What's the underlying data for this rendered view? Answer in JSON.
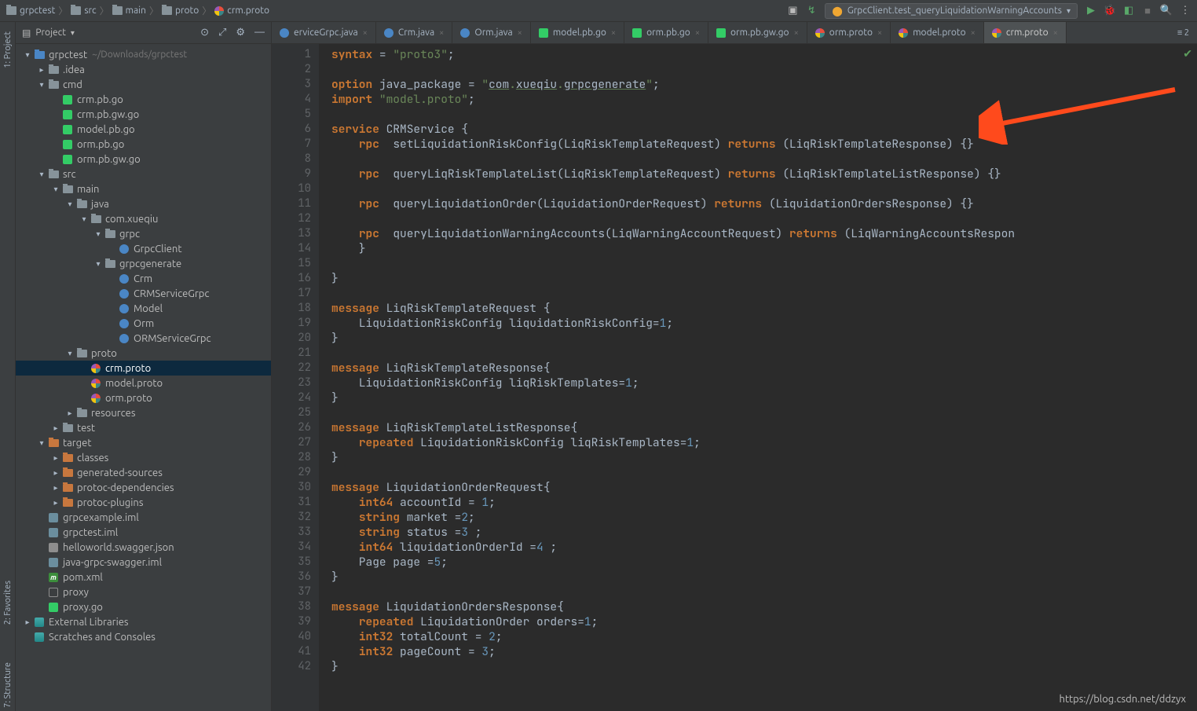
{
  "breadcrumb": [
    "grpctest",
    "src",
    "main",
    "proto",
    "crm.proto"
  ],
  "run_config": "GrpcClient.test_queryLiquidationWarningAccounts",
  "sidebar_title": "Project",
  "toolwindows": [
    "1: Project",
    "2: Favorites",
    "7: Structure"
  ],
  "tree": [
    {
      "d": 0,
      "t": "v",
      "i": "folder-blue",
      "l": "grpctest",
      "h": "~/Downloads/grpctest"
    },
    {
      "d": 1,
      "t": ">",
      "i": "folder",
      "l": ".idea"
    },
    {
      "d": 1,
      "t": "v",
      "i": "folder",
      "l": "cmd"
    },
    {
      "d": 2,
      "t": "",
      "i": "go",
      "l": "crm.pb.go"
    },
    {
      "d": 2,
      "t": "",
      "i": "go",
      "l": "crm.pb.gw.go"
    },
    {
      "d": 2,
      "t": "",
      "i": "go",
      "l": "model.pb.go"
    },
    {
      "d": 2,
      "t": "",
      "i": "go",
      "l": "orm.pb.go"
    },
    {
      "d": 2,
      "t": "",
      "i": "go",
      "l": "orm.pb.gw.go"
    },
    {
      "d": 1,
      "t": "v",
      "i": "folder",
      "l": "src"
    },
    {
      "d": 2,
      "t": "v",
      "i": "folder",
      "l": "main"
    },
    {
      "d": 3,
      "t": "v",
      "i": "folder",
      "l": "java"
    },
    {
      "d": 4,
      "t": "v",
      "i": "folder",
      "l": "com.xueqiu"
    },
    {
      "d": 5,
      "t": "v",
      "i": "folder",
      "l": "grpc"
    },
    {
      "d": 6,
      "t": "",
      "i": "java",
      "l": "GrpcClient"
    },
    {
      "d": 5,
      "t": "v",
      "i": "folder",
      "l": "grpcgenerate"
    },
    {
      "d": 6,
      "t": "",
      "i": "java",
      "l": "Crm"
    },
    {
      "d": 6,
      "t": "",
      "i": "java",
      "l": "CRMServiceGrpc"
    },
    {
      "d": 6,
      "t": "",
      "i": "java",
      "l": "Model"
    },
    {
      "d": 6,
      "t": "",
      "i": "java",
      "l": "Orm"
    },
    {
      "d": 6,
      "t": "",
      "i": "java",
      "l": "ORMServiceGrpc"
    },
    {
      "d": 3,
      "t": "v",
      "i": "folder",
      "l": "proto"
    },
    {
      "d": 4,
      "t": "",
      "i": "proto",
      "l": "crm.proto",
      "sel": true
    },
    {
      "d": 4,
      "t": "",
      "i": "proto",
      "l": "model.proto"
    },
    {
      "d": 4,
      "t": "",
      "i": "proto",
      "l": "orm.proto"
    },
    {
      "d": 3,
      "t": ">",
      "i": "folder",
      "l": "resources"
    },
    {
      "d": 2,
      "t": ">",
      "i": "folder",
      "l": "test"
    },
    {
      "d": 1,
      "t": "v",
      "i": "folder-orange",
      "l": "target"
    },
    {
      "d": 2,
      "t": ">",
      "i": "folder-orange",
      "l": "classes"
    },
    {
      "d": 2,
      "t": ">",
      "i": "folder-orange",
      "l": "generated-sources"
    },
    {
      "d": 2,
      "t": ">",
      "i": "folder-orange",
      "l": "protoc-dependencies"
    },
    {
      "d": 2,
      "t": ">",
      "i": "folder-orange",
      "l": "protoc-plugins"
    },
    {
      "d": 1,
      "t": "",
      "i": "iml",
      "l": "grpcexample.iml"
    },
    {
      "d": 1,
      "t": "",
      "i": "iml",
      "l": "grpctest.iml"
    },
    {
      "d": 1,
      "t": "",
      "i": "json",
      "l": "helloworld.swagger.json"
    },
    {
      "d": 1,
      "t": "",
      "i": "iml",
      "l": "java-grpc-swagger.iml"
    },
    {
      "d": 1,
      "t": "",
      "i": "m",
      "l": "pom.xml"
    },
    {
      "d": 1,
      "t": "",
      "i": "proxy",
      "l": "proxy"
    },
    {
      "d": 1,
      "t": "",
      "i": "go",
      "l": "proxy.go"
    },
    {
      "d": 0,
      "t": ">",
      "i": "lib",
      "l": "External Libraries"
    },
    {
      "d": 0,
      "t": "",
      "i": "lib",
      "l": "Scratches and Consoles"
    }
  ],
  "tabs": [
    {
      "l": "erviceGrpc.java",
      "i": "java"
    },
    {
      "l": "Crm.java",
      "i": "java"
    },
    {
      "l": "Orm.java",
      "i": "java"
    },
    {
      "l": "model.pb.go",
      "i": "go"
    },
    {
      "l": "orm.pb.go",
      "i": "go"
    },
    {
      "l": "orm.pb.gw.go",
      "i": "go"
    },
    {
      "l": "orm.proto",
      "i": "proto"
    },
    {
      "l": "model.proto",
      "i": "proto"
    },
    {
      "l": "crm.proto",
      "i": "proto",
      "active": true
    }
  ],
  "tabs_indicator": "≡ 2",
  "code": [
    [
      [
        "kw",
        "syntax"
      ],
      [
        "",
        " = "
      ],
      [
        "str",
        "\"proto3\""
      ],
      [
        "",
        ";"
      ]
    ],
    [],
    [
      [
        "kw",
        "option"
      ],
      [
        "",
        " java_package = "
      ],
      [
        "str",
        "\""
      ],
      [
        "ul",
        "com"
      ],
      [
        "str",
        "."
      ],
      [
        "ul",
        "xueqiu"
      ],
      [
        "str",
        "."
      ],
      [
        "ul",
        "grpcgenerate"
      ],
      [
        "str",
        "\""
      ],
      [
        "",
        ";"
      ]
    ],
    [
      [
        "kw",
        "import"
      ],
      [
        "",
        " "
      ],
      [
        "str",
        "\"model.proto\""
      ],
      [
        "",
        ";"
      ]
    ],
    [],
    [
      [
        "kw",
        "service"
      ],
      [
        "",
        " CRMService {"
      ]
    ],
    [
      [
        "",
        "    "
      ],
      [
        "kw",
        "rpc"
      ],
      [
        "",
        "  setLiquidationRiskConfig(LiqRiskTemplateRequest) "
      ],
      [
        "kw",
        "returns"
      ],
      [
        "",
        " (LiqRiskTemplateResponse) {}"
      ]
    ],
    [],
    [
      [
        "",
        "    "
      ],
      [
        "kw",
        "rpc"
      ],
      [
        "",
        "  queryLiqRiskTemplateList(LiqRiskTemplateRequest) "
      ],
      [
        "kw",
        "returns"
      ],
      [
        "",
        " (LiqRiskTemplateListResponse) {}"
      ]
    ],
    [],
    [
      [
        "",
        "    "
      ],
      [
        "kw",
        "rpc"
      ],
      [
        "",
        "  queryLiquidationOrder(LiquidationOrderRequest) "
      ],
      [
        "kw",
        "returns"
      ],
      [
        "",
        " (LiquidationOrdersResponse) {}"
      ]
    ],
    [],
    [
      [
        "",
        "    "
      ],
      [
        "kw",
        "rpc"
      ],
      [
        "",
        "  queryLiquidationWarningAccounts(LiqWarningAccountRequest) "
      ],
      [
        "kw",
        "returns"
      ],
      [
        "",
        " (LiqWarningAccountsRespon"
      ]
    ],
    [
      [
        "",
        "    }"
      ]
    ],
    [],
    [
      [
        "",
        "}"
      ]
    ],
    [],
    [
      [
        "kw",
        "message"
      ],
      [
        "",
        " LiqRiskTemplateRequest {"
      ]
    ],
    [
      [
        "",
        "    LiquidationRiskConfig liquidationRiskConfig="
      ],
      [
        "num",
        "1"
      ],
      [
        "",
        ";"
      ]
    ],
    [
      [
        "",
        "}"
      ]
    ],
    [],
    [
      [
        "kw",
        "message"
      ],
      [
        "",
        " LiqRiskTemplateResponse{"
      ]
    ],
    [
      [
        "",
        "    LiquidationRiskConfig liqRiskTemplates="
      ],
      [
        "num",
        "1"
      ],
      [
        "",
        ";"
      ]
    ],
    [
      [
        "",
        "}"
      ]
    ],
    [],
    [
      [
        "kw",
        "message"
      ],
      [
        "",
        " LiqRiskTemplateListResponse{"
      ]
    ],
    [
      [
        "",
        "    "
      ],
      [
        "kw",
        "repeated"
      ],
      [
        "",
        " LiquidationRiskConfig liqRiskTemplates="
      ],
      [
        "num",
        "1"
      ],
      [
        "",
        ";"
      ]
    ],
    [
      [
        "",
        "}"
      ]
    ],
    [],
    [
      [
        "kw",
        "message"
      ],
      [
        "",
        " LiquidationOrderRequest{"
      ]
    ],
    [
      [
        "",
        "    "
      ],
      [
        "kw",
        "int64"
      ],
      [
        "",
        " accountId = "
      ],
      [
        "num",
        "1"
      ],
      [
        "",
        ";"
      ]
    ],
    [
      [
        "",
        "    "
      ],
      [
        "kw",
        "string"
      ],
      [
        "",
        " market ="
      ],
      [
        "num",
        "2"
      ],
      [
        "",
        ";"
      ]
    ],
    [
      [
        "",
        "    "
      ],
      [
        "kw",
        "string"
      ],
      [
        "",
        " status ="
      ],
      [
        "num",
        "3"
      ],
      [
        "",
        " ;"
      ]
    ],
    [
      [
        "",
        "    "
      ],
      [
        "kw",
        "int64"
      ],
      [
        "",
        " liquidationOrderId ="
      ],
      [
        "num",
        "4"
      ],
      [
        "",
        " ;"
      ]
    ],
    [
      [
        "",
        "    Page page ="
      ],
      [
        "num",
        "5"
      ],
      [
        "",
        ";"
      ]
    ],
    [
      [
        "",
        "}"
      ]
    ],
    [],
    [
      [
        "kw",
        "message"
      ],
      [
        "",
        " LiquidationOrdersResponse{"
      ]
    ],
    [
      [
        "",
        "    "
      ],
      [
        "kw",
        "repeated"
      ],
      [
        "",
        " LiquidationOrder orders="
      ],
      [
        "num",
        "1"
      ],
      [
        "",
        ";"
      ]
    ],
    [
      [
        "",
        "    "
      ],
      [
        "kw",
        "int32"
      ],
      [
        "",
        " totalCount = "
      ],
      [
        "num",
        "2"
      ],
      [
        "",
        ";"
      ]
    ],
    [
      [
        "",
        "    "
      ],
      [
        "kw",
        "int32"
      ],
      [
        "",
        " pageCount = "
      ],
      [
        "num",
        "3"
      ],
      [
        "",
        ";"
      ]
    ],
    [
      [
        "",
        "}"
      ]
    ]
  ],
  "footer_url": "https://blog.csdn.net/ddzyx"
}
